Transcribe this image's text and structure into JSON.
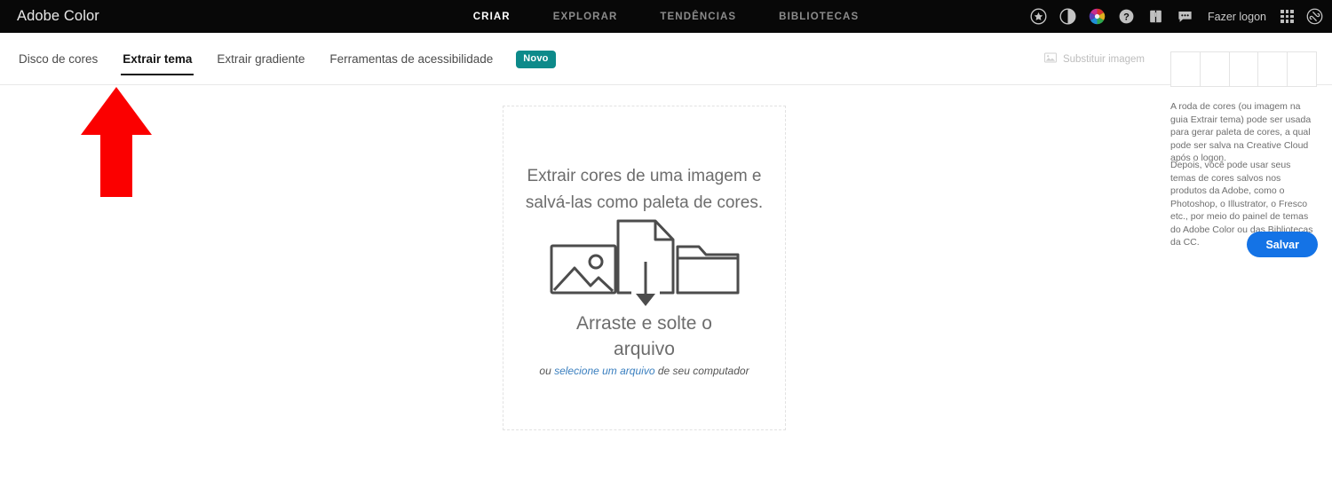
{
  "header": {
    "brand": "Adobe Color",
    "nav": [
      {
        "label": "CRIAR",
        "active": true
      },
      {
        "label": "EXPLORAR",
        "active": false
      },
      {
        "label": "TENDÊNCIAS",
        "active": false
      },
      {
        "label": "BIBLIOTECAS",
        "active": false
      }
    ],
    "icons": [
      "star-circle-icon",
      "contrast-circle-icon",
      "color-wheel-icon",
      "help-circle-icon",
      "book-alert-icon",
      "chat-bubble-icon"
    ],
    "logon_label": "Fazer logon",
    "app-grid-icon": "app-grid-icon",
    "cc-logo-icon": "creative-cloud-icon",
    "background": "#080808"
  },
  "tabs": {
    "items": [
      {
        "label": "Disco de cores",
        "active": false
      },
      {
        "label": "Extrair tema",
        "active": true
      },
      {
        "label": "Extrair gradiente",
        "active": false
      },
      {
        "label": "Ferramentas de acessibilidade",
        "active": false
      }
    ],
    "badge": "Novo",
    "badge_color": "#0d8a8a",
    "replace_image_label": "Substituir imagem"
  },
  "dropzone": {
    "title": "Extrair cores de uma imagem e salvá-las como paleta de cores.",
    "drag_title": "Arraste e solte o arquivo",
    "sub_prefix": "ou ",
    "sub_link": "selecione um arquivo",
    "sub_suffix": " de seu computador",
    "icons": [
      "image-icon",
      "file-download-icon",
      "folder-icon"
    ]
  },
  "sidebar": {
    "swatch_count": 5,
    "paragraph1": "A roda de cores (ou imagem na guia Extrair tema) pode ser usada para gerar paleta de cores, a qual pode ser salva na Creative Cloud após o logon.",
    "paragraph2": "Depois, você pode usar seus temas de cores salvos nos produtos da Adobe, como o Photoshop, o Illustrator, o Fresco etc., por meio do painel de temas do Adobe Color ou das Bibliotecas da CC.",
    "save_label": "Salvar",
    "save_color": "#1473e6"
  },
  "annotation": {
    "arrow": "red-up-arrow",
    "color": "#fb0000"
  }
}
